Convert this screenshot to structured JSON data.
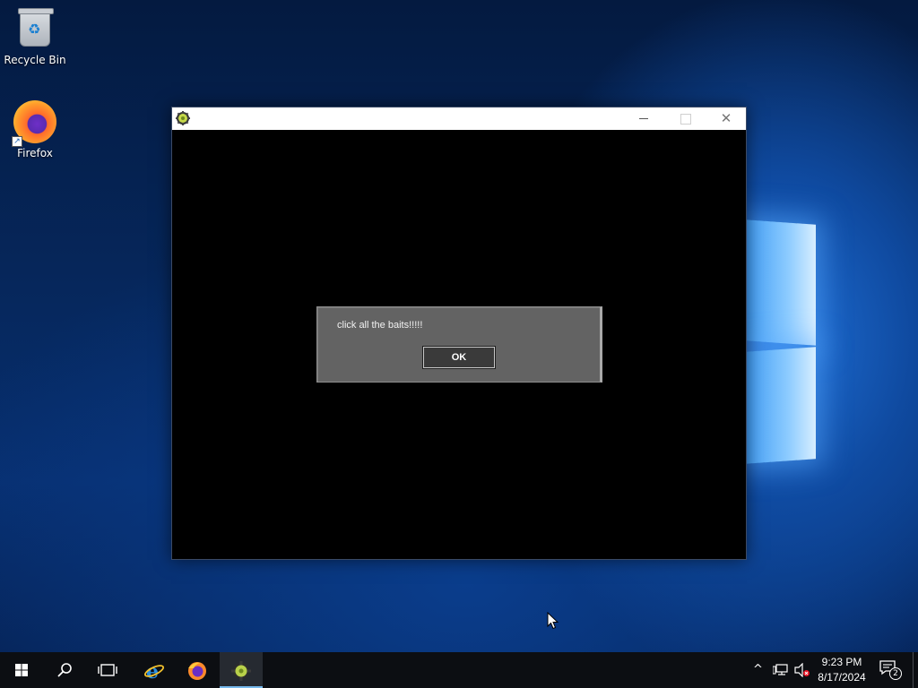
{
  "desktop": {
    "icons": [
      {
        "label": "Recycle Bin",
        "icon": "recycle-bin-icon"
      },
      {
        "label": "Firefox",
        "icon": "firefox-icon"
      }
    ]
  },
  "app_window": {
    "title": "",
    "icon": "settings-gear-icon",
    "controls": {
      "minimize": "minimize-icon",
      "maximize": "maximize-icon",
      "close": "close-icon"
    }
  },
  "dialog": {
    "message": "click all the baits!!!!!",
    "ok_label": "OK"
  },
  "taskbar": {
    "items": [
      {
        "name": "start",
        "icon": "windows-start-icon"
      },
      {
        "name": "search",
        "icon": "search-icon"
      },
      {
        "name": "task-view",
        "icon": "task-view-icon"
      },
      {
        "name": "internet-explorer",
        "icon": "internet-explorer-icon"
      },
      {
        "name": "firefox",
        "icon": "firefox-icon"
      },
      {
        "name": "running-app",
        "icon": "settings-gear-icon",
        "active": true
      }
    ],
    "tray": {
      "time": "9:23 PM",
      "date": "8/17/2024",
      "notification_count": "2"
    }
  },
  "colors": {
    "dialog_bg": "#636363",
    "window_bg": "#000000",
    "taskbar_bg": "#0c0e12",
    "active_indicator": "#76b9ed"
  }
}
